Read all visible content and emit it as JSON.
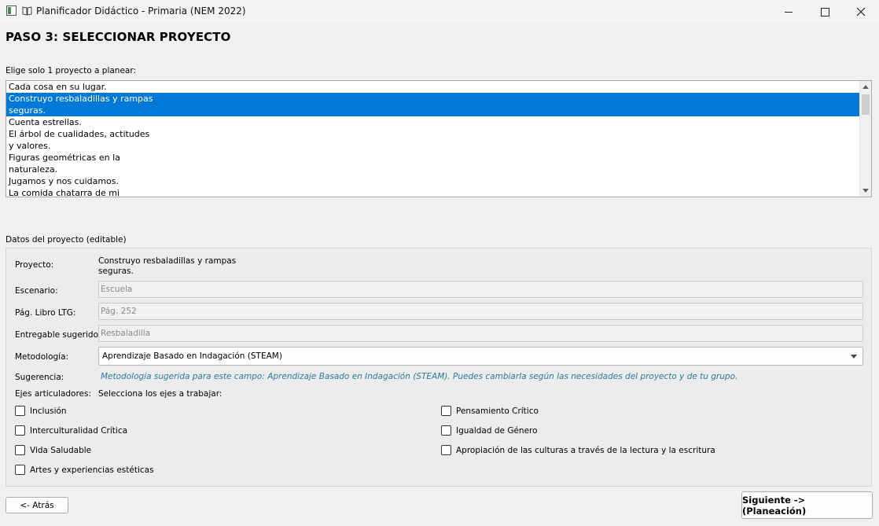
{
  "window": {
    "title": "Planificador Didáctico - Primaria (NEM 2022)",
    "icons": [
      "app-icon",
      "book-icon"
    ],
    "controls": [
      "minimize",
      "maximize",
      "close"
    ]
  },
  "heading": "PASO 3: SELECCIONAR PROYECTO",
  "project_list": {
    "label": "Elige solo 1 proyecto a planear:",
    "items": [
      "Cada cosa en su lugar.",
      "Construyo resbaladillas y rampas\nseguras.",
      "Cuenta estrellas.",
      "El árbol de cualidades, actitudes\ny valores.",
      "Figuras geométricas en la\nnaturaleza.",
      "Jugamos y nos cuidamos.",
      "La comida chatarra de mi"
    ],
    "selected_index": 1,
    "selection_color": "#0078d7"
  },
  "project_data": {
    "group_label": "Datos del proyecto (editable)",
    "project": {
      "label": "Proyecto:",
      "value": "Construyo resbaladillas y rampas\nseguras."
    },
    "scenario": {
      "label": "Escenario:",
      "value": "Escuela"
    },
    "page": {
      "label": "Pág. Libro LTG:",
      "value": "Pág. 252"
    },
    "deliverable": {
      "label": "Entregable sugerido:",
      "value": "Resbaladilla"
    },
    "methodology": {
      "label": "Metodología:",
      "value": "Aprendizaje Basado en Indagación (STEAM)"
    },
    "suggestion": {
      "label": "Sugerencia:",
      "text": "Metodología sugerida para este campo: Aprendizaje Basado en Indagación (STEAM). Puedes cambiarla según las necesidades del proyecto y de tu grupo.",
      "color": "#2a7a9a"
    },
    "axes": {
      "label": "Ejes articuladores:",
      "hint": "Selecciona los ejes a trabajar:",
      "items": [
        {
          "label": "Inclusión",
          "checked": false
        },
        {
          "label": "Pensamiento Crítico",
          "checked": false
        },
        {
          "label": "Interculturalidad Crítica",
          "checked": false
        },
        {
          "label": "Igualdad de Género",
          "checked": false
        },
        {
          "label": "Vida Saludable",
          "checked": false
        },
        {
          "label": "Apropiación de las culturas a través de la lectura y la escritura",
          "checked": false
        },
        {
          "label": "Artes y experiencias estéticas",
          "checked": false
        }
      ]
    }
  },
  "footer": {
    "back_label": "<- Atrás",
    "next_label": "Siguiente -> (Planeación)"
  }
}
